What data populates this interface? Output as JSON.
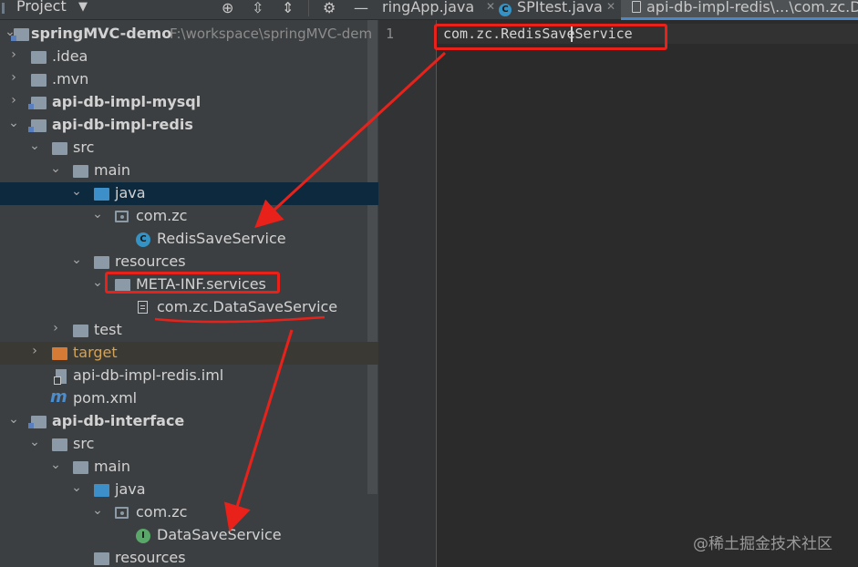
{
  "header": {
    "panel_title": "Project",
    "tabs": [
      {
        "label": "ringApp.java"
      },
      {
        "label": "SPItest.java"
      },
      {
        "label": "api-db-impl-redis\\...\\com.zc.D"
      }
    ]
  },
  "tree": {
    "root": {
      "label": "springMVC-demo",
      "path": "F:\\workspace\\springMVC-dem"
    },
    "items": [
      {
        "label": ".idea"
      },
      {
        "label": ".mvn"
      },
      {
        "label": "api-db-impl-mysql"
      },
      {
        "label": "api-db-impl-redis"
      },
      {
        "label": "src"
      },
      {
        "label": "main"
      },
      {
        "label": "java"
      },
      {
        "label": "com.zc"
      },
      {
        "label": "RedisSaveService"
      },
      {
        "label": "resources"
      },
      {
        "label": "META-INF.services"
      },
      {
        "label": "com.zc.DataSaveService"
      },
      {
        "label": "test"
      },
      {
        "label": "target"
      },
      {
        "label": "api-db-impl-redis.iml"
      },
      {
        "label": "pom.xml"
      },
      {
        "label": "api-db-interface"
      },
      {
        "label": "src"
      },
      {
        "label": "main"
      },
      {
        "label": "java"
      },
      {
        "label": "com.zc"
      },
      {
        "label": "DataSaveService"
      },
      {
        "label": "resources"
      }
    ]
  },
  "editor": {
    "line_number": "1",
    "code_line": "com.zc.RedisSaveService"
  },
  "watermark": "@稀土掘金技术社区",
  "colors": {
    "annotation": "#e8221b",
    "selection": "#0d293e",
    "accent": "#4a88c7"
  }
}
